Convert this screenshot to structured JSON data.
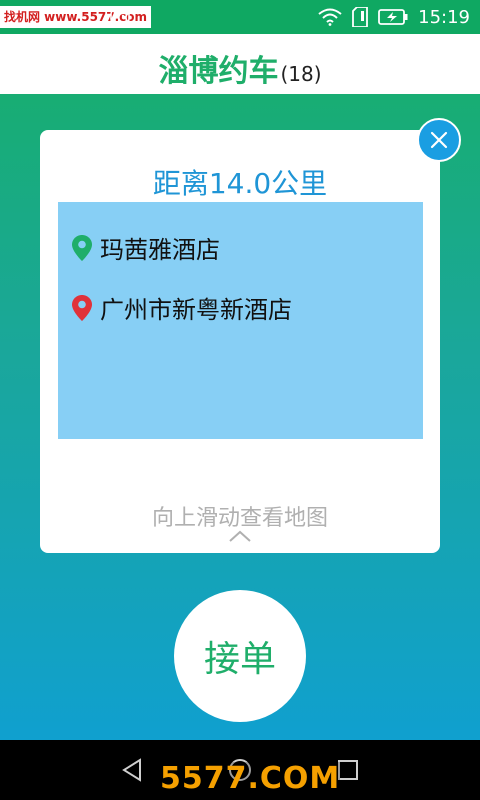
{
  "status_bar": {
    "watermark": "找机网 www.5577.com",
    "time": "15:19",
    "icons": [
      "cat-notification-icon",
      "wifi-icon",
      "sim-icon",
      "battery-charging-icon"
    ]
  },
  "header": {
    "title": "淄博约车",
    "count": "(18)"
  },
  "card": {
    "distance": "距离14.0公里",
    "origin": "玛茜雅酒店",
    "destination": "广州市新粤新酒店",
    "hint": "向上滑动查看地图",
    "close_icon": "close-icon"
  },
  "accept_button": {
    "label": "接单"
  },
  "nav_bar": {
    "icons": [
      "back-icon",
      "home-icon",
      "recents-icon"
    ],
    "watermark": "5577.COM"
  },
  "colors": {
    "brand_green": "#1fae6a",
    "accent_blue": "#1f95d6",
    "route_box": "#87cff5",
    "origin_pin": "#1fae6a",
    "destination_pin": "#e0323a"
  }
}
